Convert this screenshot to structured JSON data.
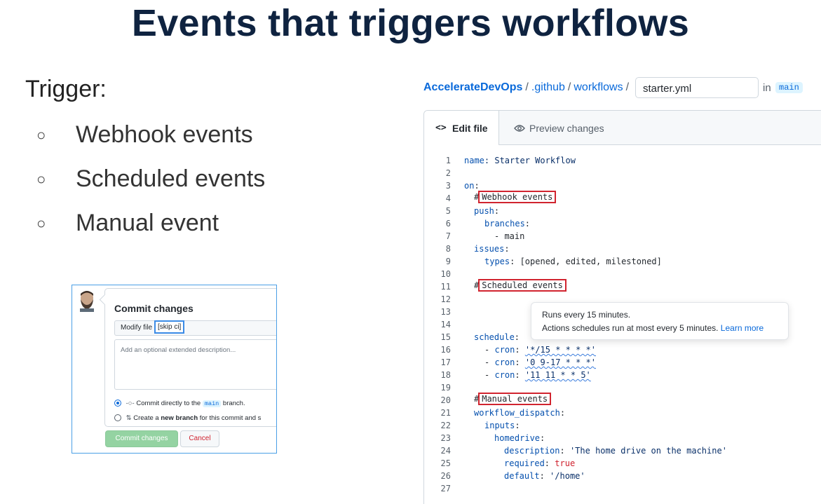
{
  "slide": {
    "title": "Events that triggers workflows",
    "trigger_label": "Trigger:",
    "bullet_glyph": "○",
    "bullets": [
      "Webhook events",
      "Scheduled events",
      "Manual event"
    ]
  },
  "commit_panel": {
    "title": "Commit changes",
    "summary_value": "Modify file",
    "skip_ci": "[skip ci]",
    "description_placeholder": "Add an optional extended description...",
    "option_direct_prefix": "Commit directly to the",
    "option_direct_branch": "main",
    "option_direct_suffix": "branch.",
    "option_new_prefix": "Create a",
    "option_new_bold": "new branch",
    "option_new_suffix": "for this commit and s",
    "commit_button": "Commit changes",
    "cancel_button": "Cancel"
  },
  "editor": {
    "breadcrumb": {
      "repo": "AccelerateDevOps",
      "sep": "/",
      "dir1": ".github",
      "dir2": "workflows",
      "filename": "starter.yml",
      "in_label": "in",
      "branch": "main"
    },
    "tabs": {
      "edit": "Edit file",
      "preview": "Preview changes"
    },
    "tooltip": {
      "line1": "Runs every 15 minutes.",
      "line2": "Actions schedules run at most every 5 minutes.",
      "learn_more": "Learn more"
    },
    "line_numbers": [
      "1",
      "2",
      "3",
      "4",
      "5",
      "6",
      "7",
      "8",
      "9",
      "10",
      "11",
      "12",
      "13",
      "14",
      "15",
      "16",
      "17",
      "18",
      "19",
      "20",
      "21",
      "22",
      "23",
      "24",
      "25",
      "26",
      "27"
    ],
    "code": {
      "l1_key": "name",
      "l1_val": ": Starter Workflow",
      "l3_key": "on",
      "l3_val": ":",
      "hash": "#",
      "l4_comment": "Webhook events",
      "l5_key": "push",
      "colon": ":",
      "l6_key": "branches",
      "l7_val": "- main",
      "l8_key": "issues",
      "l9_key": "types",
      "l9_val": ": [opened, edited, milestoned]",
      "l11_comment": "Scheduled events",
      "l15_key": "schedule",
      "dash": "-",
      "cron_key": "cron",
      "l16_val": "'*/15 * * * *'",
      "l17_val": "'0 9-17 * * *'",
      "l18_val": "'11 11 * * 5'",
      "l20_comment": "Manual events",
      "l21_key": "workflow_dispatch",
      "l22_key": "inputs",
      "l23_key": "homedrive",
      "l24_key": "description",
      "l24_val": "'The home drive on the machine'",
      "l25_key": "required",
      "l25_val": "true",
      "l26_key": "default",
      "l26_val": "'/home'"
    }
  },
  "colors": {
    "title": "#0f2340",
    "link": "#0969da",
    "highlight_red": "#d1242f",
    "highlight_blue": "#3b8be6",
    "commit_green": "#94d3a2"
  }
}
